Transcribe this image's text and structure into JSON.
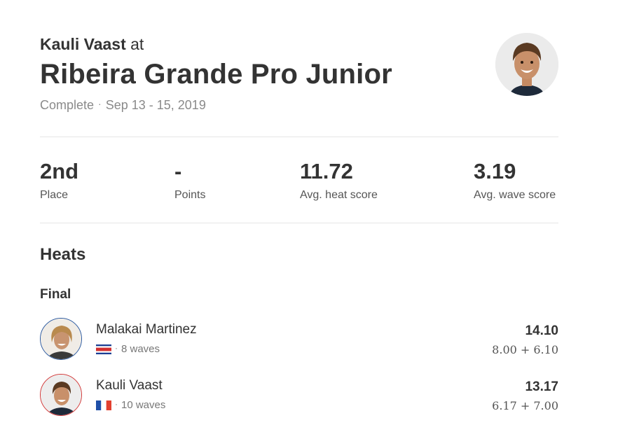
{
  "header": {
    "athlete_name": "Kauli Vaast",
    "athlete_suffix": "at",
    "event_title": "Ribeira Grande Pro Junior",
    "status": "Complete",
    "separator": "·",
    "dates": "Sep 13 - 15, 2019"
  },
  "stats": [
    {
      "value": "2nd",
      "label": "Place"
    },
    {
      "value": "-",
      "label": "Points"
    },
    {
      "value": "11.72",
      "label": "Avg. heat score"
    },
    {
      "value": "3.19",
      "label": "Avg. wave score"
    }
  ],
  "heats": {
    "title": "Heats",
    "rounds": [
      {
        "name": "Final",
        "surfers": [
          {
            "name": "Malakai Martinez",
            "country_flag": "costa-rica-flag-icon",
            "separator": "·",
            "waves": "8 waves",
            "total": "14.10",
            "wave_scores": "8.00 + 6.10",
            "avatar_ring_color": "#2c5aa0"
          },
          {
            "name": "Kauli Vaast",
            "country_flag": "france-flag-icon",
            "separator": "·",
            "waves": "10 waves",
            "total": "13.17",
            "wave_scores": "6.17 + 7.00",
            "avatar_ring_color": "#d33a3a"
          }
        ]
      }
    ]
  },
  "colors": {
    "text_primary": "#333333",
    "text_muted": "#8a8a8a",
    "divider": "#e6e6e6"
  }
}
